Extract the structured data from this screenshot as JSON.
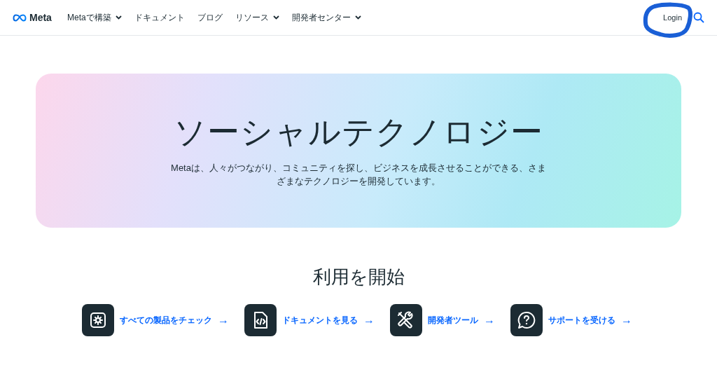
{
  "header": {
    "logo": "Meta",
    "nav": [
      {
        "label": "Metaで構築",
        "dropdown": true
      },
      {
        "label": "ドキュメント",
        "dropdown": false
      },
      {
        "label": "ブログ",
        "dropdown": false
      },
      {
        "label": "リソース",
        "dropdown": true
      },
      {
        "label": "開発者センター",
        "dropdown": true
      }
    ],
    "login": "Login"
  },
  "hero": {
    "title": "ソーシャルテクノロジー",
    "description": "Metaは、人々がつながり、コミュニティを探し、ビジネスを成長させることができる、さまざまなテクノロジーを開発しています。"
  },
  "get_started": {
    "heading": "利用を開始",
    "links": [
      {
        "kind": "gear",
        "label": "すべての製品をチェック",
        "arrow": "→"
      },
      {
        "kind": "code",
        "label": "ドキュメントを見る",
        "arrow": "→"
      },
      {
        "kind": "tools",
        "label": "開発者ツール",
        "arrow": "→"
      },
      {
        "kind": "help",
        "label": "サポートを受ける",
        "arrow": "→"
      }
    ]
  }
}
